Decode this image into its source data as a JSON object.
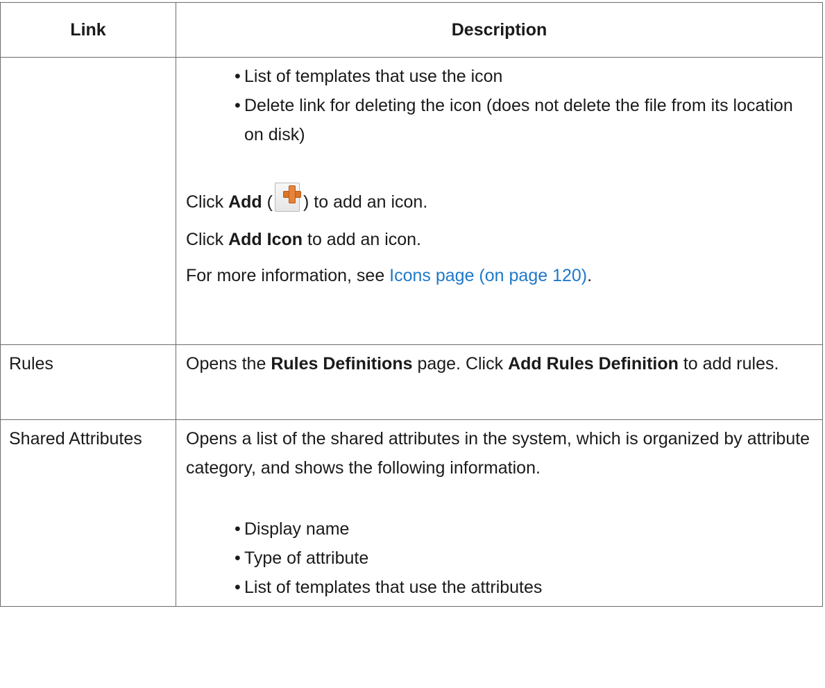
{
  "table": {
    "headers": {
      "link": "Link",
      "description": "Description"
    },
    "row_icons": {
      "bullets": [
        "List of templates that use the icon",
        "Delete link for deleting the icon (does not delete the file from its location on disk)"
      ],
      "click_add": {
        "prefix": "Click ",
        "bold": "Add",
        "open": " (",
        "close": ") to add an icon.",
        "icon": "add-file-icon"
      },
      "click_add_icon": {
        "prefix": "Click ",
        "bold": "Add Icon",
        "suffix": " to add an icon."
      },
      "more_info": {
        "prefix": "For more information, see ",
        "link": "Icons page (on page 120)",
        "suffix": "."
      }
    },
    "row_rules": {
      "link": "Rules",
      "desc_prefix": "Opens the ",
      "desc_bold1": "Rules Definitions",
      "desc_mid": " page. Click ",
      "desc_bold2": "Add Rules Definition",
      "desc_suffix": " to add rules."
    },
    "row_shared": {
      "link": "Shared Attributes",
      "desc": "Opens a list of the shared attributes in the system, which is organized by attribute category, and shows the following information.",
      "bullets": [
        "Display name",
        "Type of attribute",
        "List of templates that use the attributes"
      ]
    }
  }
}
